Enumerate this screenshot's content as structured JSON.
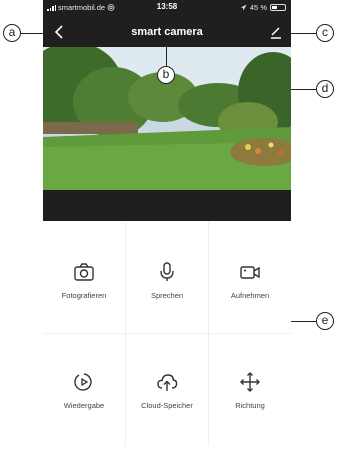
{
  "status_bar": {
    "carrier": "smartmobil.de",
    "time": "13:58",
    "battery": "45 %",
    "battery_level": 0.45
  },
  "header": {
    "title": "smart camera"
  },
  "actions": [
    {
      "label": "Fotografieren",
      "icon": "camera-icon"
    },
    {
      "label": "Sprechen",
      "icon": "microphone-icon"
    },
    {
      "label": "Aufnehmen",
      "icon": "video-record-icon"
    },
    {
      "label": "Wiedergabe",
      "icon": "playback-icon"
    },
    {
      "label": "Cloud-Speicher",
      "icon": "cloud-icon"
    },
    {
      "label": "Richtung",
      "icon": "direction-icon"
    }
  ],
  "callouts": {
    "a": "a",
    "b": "b",
    "c": "c",
    "d": "d",
    "e": "e"
  },
  "colors": {
    "bar": "#1f1f1f",
    "icon": "#333333"
  }
}
